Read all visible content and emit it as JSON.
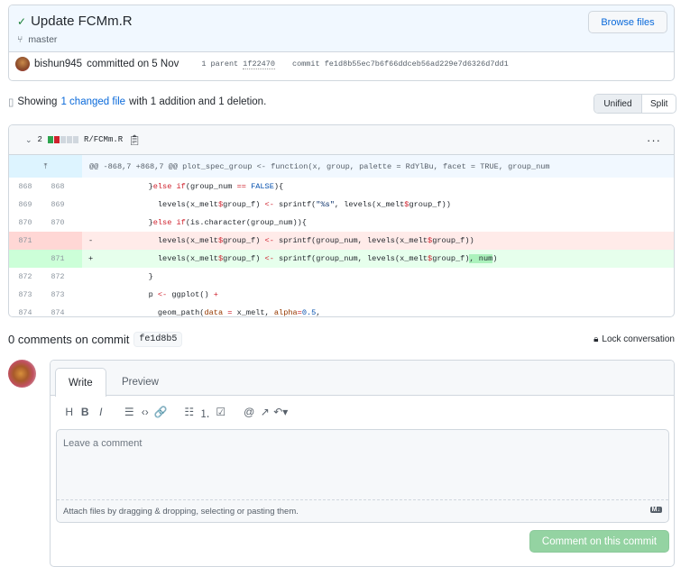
{
  "commit": {
    "title": "Update FCMm.R",
    "branch": "master",
    "browse_label": "Browse files",
    "author": "bishun945",
    "committed_text": "committed on 5 Nov",
    "parent_label": "1 parent",
    "parent_sha": "1f22470",
    "commit_label": "commit",
    "sha": "fe1d8b55ec7b6f66ddceb56ad229e7d6326d7dd1"
  },
  "summary": {
    "prefix": "Showing",
    "link": "1 changed file",
    "suffix": "with 1 addition and 1 deletion."
  },
  "view": {
    "unified": "Unified",
    "split": "Split",
    "selected": "Unified"
  },
  "file": {
    "changes": "2",
    "path": "R/FCMm.R",
    "colors": {
      "add": "#2da44e",
      "del": "#cf222e",
      "neutral": "#d0d7de"
    }
  },
  "hunk": "@@ -868,7 +868,7 @@ plot_spec_group <- function(x, group, palette = RdYlBu, facet = TRUE, group_num",
  "lines": [
    {
      "type": "ctx",
      "old": "868",
      "new": "868",
      "sign": "",
      "tokens": [
        [
          "          }",
          ""
        ],
        [
          "else if",
          "k"
        ],
        [
          "(group_num ",
          ""
        ],
        [
          "==",
          "k"
        ],
        [
          " ",
          ""
        ],
        [
          "FALSE",
          "c"
        ],
        [
          "){",
          ""
        ]
      ]
    },
    {
      "type": "ctx",
      "old": "869",
      "new": "869",
      "sign": "",
      "tokens": [
        [
          "            levels(x_melt",
          ""
        ],
        [
          "$",
          "k"
        ],
        [
          "group_f) ",
          ""
        ],
        [
          "<-",
          "k"
        ],
        [
          " sprintf(",
          ""
        ],
        [
          "\"%s\"",
          "s"
        ],
        [
          ", levels(x_melt",
          ""
        ],
        [
          "$",
          "k"
        ],
        [
          "group_f))",
          ""
        ]
      ]
    },
    {
      "type": "ctx",
      "old": "870",
      "new": "870",
      "sign": "",
      "tokens": [
        [
          "          }",
          ""
        ],
        [
          "else if",
          "k"
        ],
        [
          "(is.character(group_num)){",
          ""
        ]
      ]
    },
    {
      "type": "del",
      "old": "871",
      "new": "",
      "sign": "-",
      "tokens": [
        [
          "            levels(x_melt",
          ""
        ],
        [
          "$",
          "k"
        ],
        [
          "group_f) ",
          ""
        ],
        [
          "<-",
          "k"
        ],
        [
          " sprintf(group_num, levels(x_melt",
          ""
        ],
        [
          "$",
          "k"
        ],
        [
          "group_f))",
          ""
        ]
      ]
    },
    {
      "type": "add",
      "old": "",
      "new": "871",
      "sign": "+",
      "tokens": [
        [
          "            levels(x_melt",
          ""
        ],
        [
          "$",
          "k"
        ],
        [
          "group_f) ",
          ""
        ],
        [
          "<-",
          "k"
        ],
        [
          " sprintf(group_num, levels(x_melt",
          ""
        ],
        [
          "$",
          "k"
        ],
        [
          "group_f)",
          ""
        ],
        [
          ", num",
          "hl"
        ],
        [
          ")",
          ""
        ]
      ]
    },
    {
      "type": "ctx",
      "old": "872",
      "new": "872",
      "sign": "",
      "tokens": [
        [
          "          }",
          ""
        ]
      ]
    },
    {
      "type": "ctx",
      "old": "873",
      "new": "873",
      "sign": "",
      "tokens": [
        [
          "          p ",
          ""
        ],
        [
          "<-",
          "k"
        ],
        [
          " ggplot() ",
          ""
        ],
        [
          "+",
          "k"
        ]
      ]
    },
    {
      "type": "ctx",
      "old": "874",
      "new": "874",
      "sign": "",
      "tokens": [
        [
          "            geom_path(",
          ""
        ],
        [
          "data",
          "o"
        ],
        [
          " ",
          ""
        ],
        [
          "=",
          "k"
        ],
        [
          " x_melt, ",
          ""
        ],
        [
          "alpha",
          "o"
        ],
        [
          "=",
          "k"
        ],
        [
          "0.5",
          "c"
        ],
        [
          ",",
          ""
        ]
      ]
    }
  ],
  "comments": {
    "heading": "0 comments on commit",
    "sha": "fe1d8b5",
    "lock": "Lock conversation"
  },
  "editor": {
    "tabs": [
      "Write",
      "Preview"
    ],
    "active_tab": "Write",
    "toolbar": [
      "H",
      "B",
      "I",
      "☰",
      "‹›",
      "🔗",
      "☷",
      "⒈",
      "☑",
      "@",
      "↗",
      "↶▾"
    ],
    "toolbar_icons": [
      "heading-icon",
      "bold-icon",
      "italic-icon",
      "quote-icon",
      "code-icon",
      "link-icon",
      "bulleted-list-icon",
      "numbered-list-icon",
      "task-list-icon",
      "mention-icon",
      "cross-reference-icon",
      "reply-icon"
    ],
    "placeholder": "Leave a comment",
    "attach": "Attach files by dragging & dropping, selecting or pasting them.",
    "md_badge": "M↓",
    "submit": "Comment on this commit"
  }
}
